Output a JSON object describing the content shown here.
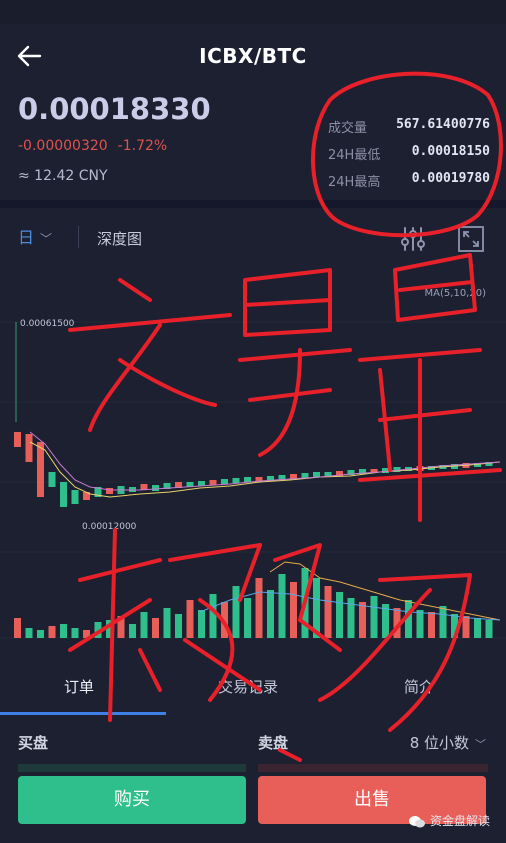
{
  "header": {
    "title": "ICBX/BTC",
    "back_icon": "arrow-left-icon"
  },
  "ticker": {
    "last_price": "0.00018330",
    "change_abs": "-0.00000320",
    "change_pct": "-1.72%",
    "cny_value": "≈ 12.42 CNY"
  },
  "stats": [
    {
      "label": "成交量",
      "value": "567.61400776"
    },
    {
      "label": "24H最低",
      "value": "0.00018150"
    },
    {
      "label": "24H最高",
      "value": "0.00019780"
    }
  ],
  "toolbar": {
    "period": "日",
    "depth_tab": "深度图",
    "settings_icon": "sliders-icon",
    "fullscreen_icon": "expand-icon"
  },
  "chart": {
    "ma_label": "MA(5,10,20)",
    "high_marker": "0.00061500",
    "low_marker": "0.00012000"
  },
  "tabs": [
    {
      "label": "订单",
      "active": true
    },
    {
      "label": "交易记录",
      "active": false
    },
    {
      "label": "简介",
      "active": false
    }
  ],
  "order_book": {
    "buy_header": "买盘",
    "sell_header": "卖盘",
    "decimals": "8 位小数"
  },
  "actions": {
    "buy_label": "购买",
    "sell_label": "出售"
  },
  "watermark": "资金盘解读",
  "colors": {
    "background": "#1c2030",
    "up": "#2fbf8c",
    "down": "#e85f5a",
    "accent": "#3f7fe8",
    "annotation": "#e8202a"
  }
}
